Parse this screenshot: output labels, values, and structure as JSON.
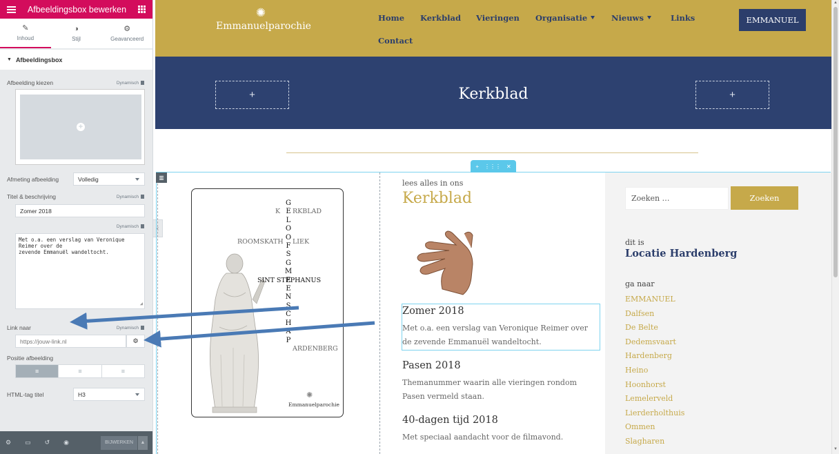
{
  "panel": {
    "header_title": "Afbeeldingsbox bewerken",
    "tabs": [
      {
        "label": "Inhoud",
        "icon": "pencil-icon"
      },
      {
        "label": "Stijl",
        "icon": "contrast-icon"
      },
      {
        "label": "Geavanceerd",
        "icon": "gear-icon"
      }
    ],
    "section_title": "Afbeeldingsbox",
    "image_label": "Afbeelding kiezen",
    "dynamic_label": "Dynamisch",
    "size_label": "Afmeting afbeelding",
    "size_value": "Volledig",
    "title_label": "Titel & beschrijving",
    "title_value": "Zomer 2018",
    "description_value": "Met o.a. een verslag van Veronique\nReimer over de\nzevende Emmanuël wandeltocht.",
    "link_label": "Link naar",
    "link_placeholder": "https://jouw-link.nl",
    "position_label": "Positie afbeelding",
    "position_options": [
      "≡",
      "≡",
      "≡"
    ],
    "html_tag_label": "HTML-tag titel",
    "html_tag_value": "H3",
    "update_button": "BIJWERKEN"
  },
  "site": {
    "logo_text": "Emmanuelparochie",
    "nav": [
      {
        "label": "Home"
      },
      {
        "label": "Kerkblad"
      },
      {
        "label": "Vieringen"
      },
      {
        "label": "Organisatie"
      },
      {
        "label": "Nieuws"
      },
      {
        "label": "Links"
      },
      {
        "label": "Contact"
      }
    ],
    "cta_button": "EMMANUEL",
    "banner_title": "Kerkblad",
    "card": {
      "vertical_word": [
        "G",
        "E",
        "L",
        "O",
        "O",
        "F",
        "S",
        "G",
        "M",
        "E",
        "E",
        "N",
        "S",
        "C",
        "H",
        "A",
        "P"
      ],
      "kerkblad_rest": "RKBLAD",
      "rooms_left": "ROOMSKATH",
      "rooms_right": "LIEK",
      "stephanus": "SINT STEPHANUS",
      "harden_rest": "ARDENBERG",
      "brand": "Emmanuelparochie"
    },
    "intro_small": "lees alles in ons",
    "intro_heading": "Kerkblad",
    "posts": [
      {
        "title": "Zomer 2018",
        "text": "Met o.a. een verslag van Veronique Reimer over de zevende Emmanuël wandeltocht."
      },
      {
        "title": "Pasen 2018",
        "text": "Themanummer waarin alle vieringen rondom Pasen vermeld staan."
      },
      {
        "title": "40-dagen tijd 2018",
        "text": "Met speciaal aandacht voor de filmavond."
      }
    ],
    "search_placeholder": "Zoeken …",
    "search_button": "Zoeken",
    "sidebar_small": "dit is",
    "sidebar_location": "Locatie Hardenberg",
    "sidebar_goto": "ga naar",
    "locations": [
      "EMMANUEL",
      "Dalfsen",
      "De Belte",
      "Dedemsvaart",
      "Hardenberg",
      "Heino",
      "Hoonhorst",
      "Lemelerveld",
      "Lierderholthuis",
      "Ommen",
      "Slagharen"
    ]
  },
  "colors": {
    "accent_pink": "#d30c5c",
    "gold": "#c6a94a",
    "navy": "#2c3e6b",
    "arrow_blue": "#4a7ab5"
  }
}
